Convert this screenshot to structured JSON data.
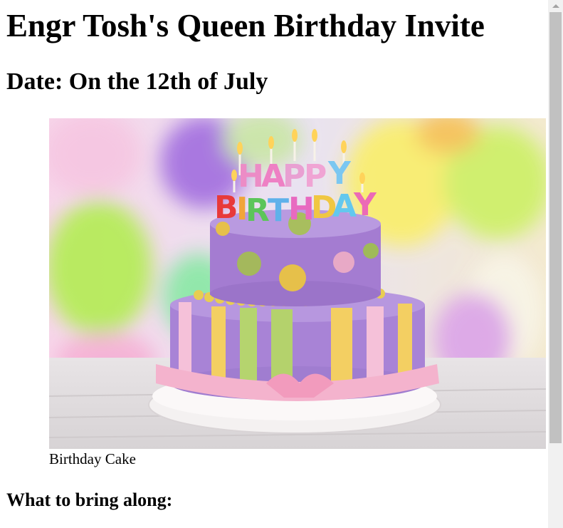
{
  "page": {
    "title": "Engr Tosh's Queen Birthday Invite",
    "date_heading": "Date: On the 12th of July",
    "figure": {
      "image_alt": "Birthday Cake",
      "candle_text": [
        "HAPPY",
        "BIRTHDAY"
      ],
      "caption": "Birthday Cake"
    },
    "bring_heading": "What to bring along:"
  },
  "icons": {
    "scroll_up": "triangle-up-icon"
  },
  "colors": {
    "scrollbar_track": "#f1f1f1",
    "scrollbar_thumb": "#c1c1c1"
  }
}
